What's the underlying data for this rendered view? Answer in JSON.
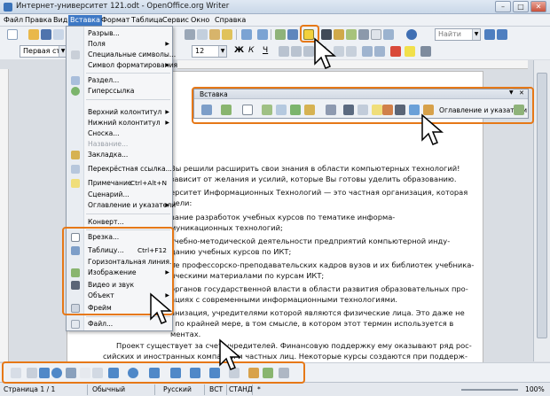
{
  "window": {
    "title": "Интернет-университет 121.odt - OpenOffice.org Writer",
    "minimize": "–",
    "maximize": "□",
    "close": "✕"
  },
  "menubar": [
    "Файл",
    "Правка",
    "Вид",
    "Вставка",
    "Формат",
    "Таблица",
    "Сервис",
    "Окно",
    "Справка"
  ],
  "format_toolbar": {
    "style": "Первая строк",
    "size": "12",
    "font_name": "Найти"
  },
  "insert_menu": {
    "items": [
      {
        "label": "Разрыв...",
        "shortcut": "",
        "arrow": false,
        "disabled": false
      },
      {
        "label": "Поля",
        "shortcut": "",
        "arrow": true,
        "disabled": false
      },
      {
        "label": "Специальные символы...",
        "shortcut": "",
        "arrow": false,
        "disabled": false
      },
      {
        "label": "Символ форматирования",
        "shortcut": "",
        "arrow": true,
        "disabled": false
      },
      {
        "label": "Раздел...",
        "shortcut": "",
        "arrow": false,
        "disabled": false
      },
      {
        "label": "Гиперссылка",
        "shortcut": "",
        "arrow": false,
        "disabled": false
      },
      {
        "label": "Верхний колонтитул",
        "shortcut": "",
        "arrow": true,
        "disabled": false
      },
      {
        "label": "Нижний колонтитул",
        "shortcut": "",
        "arrow": true,
        "disabled": false
      },
      {
        "label": "Сноска...",
        "shortcut": "",
        "arrow": false,
        "disabled": false
      },
      {
        "label": "Название...",
        "shortcut": "",
        "arrow": false,
        "disabled": true
      },
      {
        "label": "Закладка...",
        "shortcut": "",
        "arrow": false,
        "disabled": false
      },
      {
        "label": "Перекрёстная ссылка...",
        "shortcut": "",
        "arrow": false,
        "disabled": false
      },
      {
        "label": "Примечание",
        "shortcut": "Ctrl+Alt+N",
        "arrow": false,
        "disabled": false
      },
      {
        "label": "Сценарий...",
        "shortcut": "",
        "arrow": false,
        "disabled": false
      },
      {
        "label": "Оглавление и указатели",
        "shortcut": "",
        "arrow": true,
        "disabled": false
      },
      {
        "label": "Конверт...",
        "shortcut": "",
        "arrow": false,
        "disabled": false
      },
      {
        "label": "Врезка...",
        "shortcut": "",
        "arrow": false,
        "disabled": false
      },
      {
        "label": "Таблицу...",
        "shortcut": "Ctrl+F12",
        "arrow": false,
        "disabled": false
      },
      {
        "label": "Горизонтальная линия...",
        "shortcut": "",
        "arrow": false,
        "disabled": false
      },
      {
        "label": "Изображение",
        "shortcut": "",
        "arrow": true,
        "disabled": false
      },
      {
        "label": "Видео и звук",
        "shortcut": "",
        "arrow": false,
        "disabled": false
      },
      {
        "label": "Объект",
        "shortcut": "",
        "arrow": true,
        "disabled": false
      },
      {
        "label": "Фрейм",
        "shortcut": "",
        "arrow": false,
        "disabled": false
      },
      {
        "label": "Файл...",
        "shortcut": "",
        "arrow": false,
        "disabled": false
      }
    ]
  },
  "floating_toolbar": {
    "title": "Вставка",
    "close": "✕",
    "toc_label": "Оглавление и указатели"
  },
  "document": {
    "lines": [
      "Вы решили расширить свои знания в области компьютерных технологий!",
      "зависит от желания и усилий, которые Вы готовы уделить образованию.",
      "ерситет Информационных Технологий — это частная организация, которая",
      "цели:",
      "вание    разработок    учебных    курсов    по    тематике    информа-",
      "муникационных технологий;",
      "учебно-методической деятельности предприятий компьютерной инду-",
      "данию учебных курсов по ИКТ;",
      "не профессорско-преподавательских кадров вузов и их библиотек учебника-",
      "ическими материалами по курсам ИКТ;",
      "органов государственной власти в области развития образовательных про-",
      "ациях с современными информационными технологиями.",
      "анизация, учредителями которой являются физические лица. Это даже не",
      ", по крайней мере, в том смысле, в котором этот термин используется в",
      "ментах.",
      "Проект существует за счет учредителей. Финансовую поддержку ему оказывают ряд рос-",
      "сийских и иностранных компаний и частных лиц. Некоторые курсы создаются при поддерж-"
    ]
  },
  "status": {
    "page": "Страница 1 / 1",
    "style": "Обычный",
    "lang": "Русский",
    "ins": "ВСТ",
    "std": "СТАНД",
    "star": "*",
    "zoom": "100%"
  },
  "colors": {
    "highlight": "#e67817",
    "selected_menu": "#3d78c5"
  }
}
